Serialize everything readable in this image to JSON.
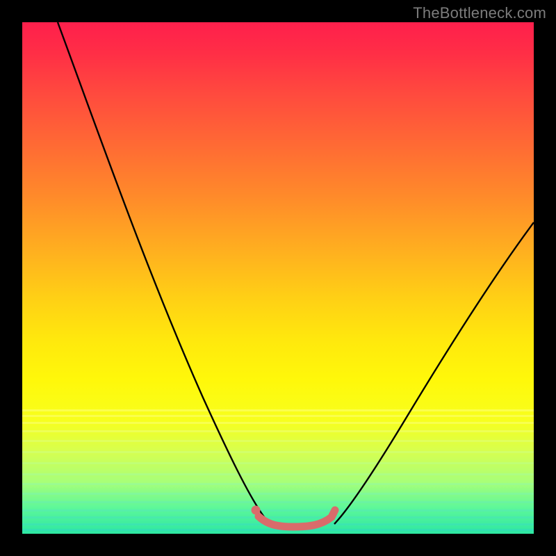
{
  "watermark": "TheBottleneck.com",
  "chart_data": {
    "type": "line",
    "title": "",
    "xlabel": "",
    "ylabel": "",
    "xlim": [
      0,
      100
    ],
    "ylim": [
      0,
      100
    ],
    "grid": false,
    "legend": null,
    "series": [
      {
        "name": "left-curve",
        "x": [
          7,
          10,
          14,
          18,
          23,
          27,
          31,
          35,
          38,
          41,
          43.5,
          45.5,
          47,
          48.5
        ],
        "values": [
          100,
          90,
          78,
          66,
          54,
          44,
          34,
          25,
          18,
          12,
          8,
          5,
          3,
          2
        ]
      },
      {
        "name": "right-curve",
        "x": [
          61,
          63,
          66,
          70,
          74,
          79,
          84,
          89,
          94,
          100
        ],
        "values": [
          2,
          4,
          8,
          14,
          21,
          29,
          37,
          45,
          53,
          61
        ]
      },
      {
        "name": "bottom-pink-segment",
        "x": [
          46,
          48.5,
          52,
          56,
          59,
          61
        ],
        "values": [
          3.5,
          1.8,
          1.5,
          1.5,
          2,
          4
        ]
      },
      {
        "name": "pink-dot",
        "x": [
          46
        ],
        "values": [
          4.2
        ]
      }
    ],
    "background_gradient": {
      "top": "#ff1f4c",
      "mid": "#fff80a",
      "bottom": "#2de7a2"
    }
  }
}
